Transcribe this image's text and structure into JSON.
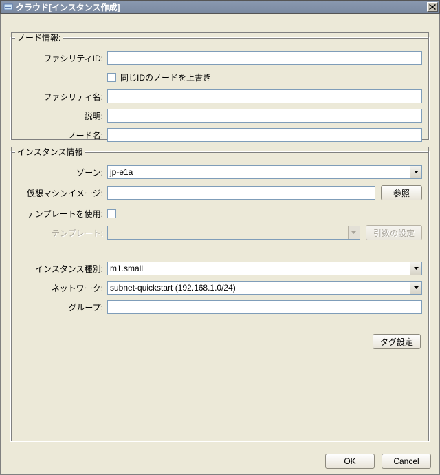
{
  "window": {
    "title": "クラウド[インスタンス作成]"
  },
  "node_info": {
    "legend": "ノード情報:",
    "facility_id_label": "ファシリティID:",
    "facility_id_value": "",
    "overwrite_label": "同じIDのノードを上書き",
    "facility_name_label": "ファシリティ名:",
    "facility_name_value": "",
    "description_label": "説明:",
    "description_value": "",
    "node_name_label": "ノード名:",
    "node_name_value": ""
  },
  "instance_info": {
    "legend": "インスタンス情報",
    "zone_label": "ゾーン:",
    "zone_value": "jp-e1a",
    "vm_image_label": "仮想マシンイメージ:",
    "vm_image_value": "",
    "browse_button": "参照",
    "use_template_label": "テンプレートを使用:",
    "template_label": "テンプレート:",
    "template_value": "",
    "arg_settings_button": "引数の設定",
    "instance_type_label": "インスタンス種別:",
    "instance_type_value": "m1.small",
    "network_label": "ネットワーク:",
    "network_value": "subnet-quickstart (192.168.1.0/24)",
    "group_label": "グループ:",
    "group_value": "",
    "tag_settings_button": "タグ設定"
  },
  "footer": {
    "ok": "OK",
    "cancel": "Cancel"
  }
}
